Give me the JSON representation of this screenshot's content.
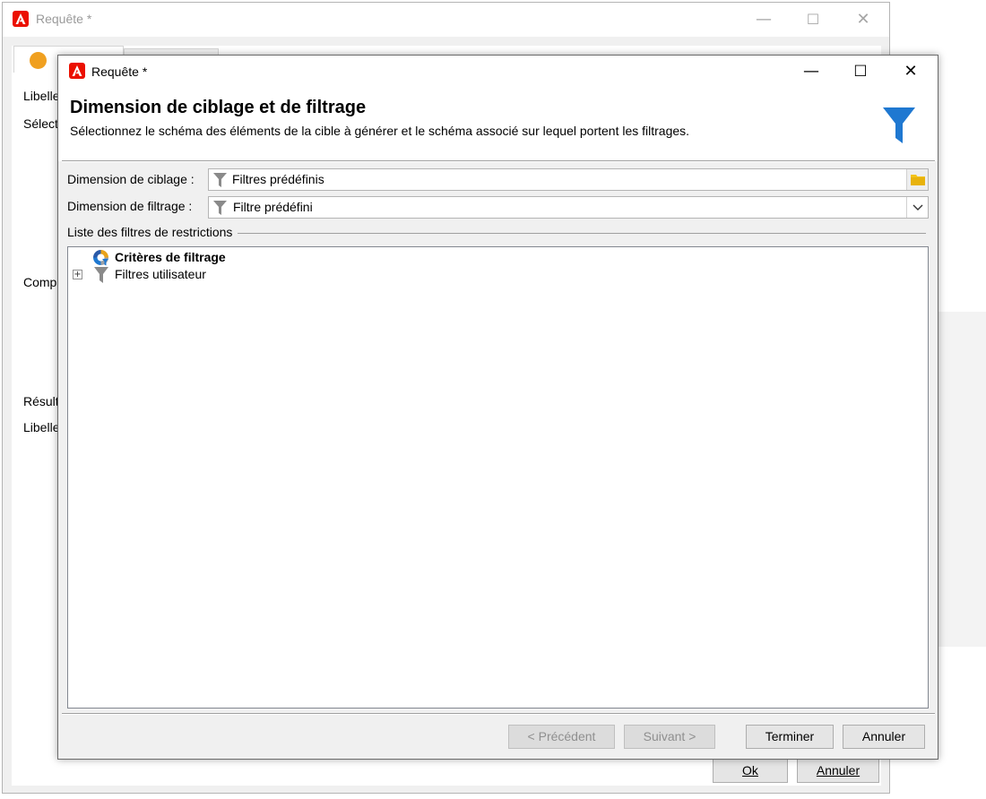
{
  "back_window": {
    "title": "Requête *",
    "labels": [
      "Libelle",
      "Sélect",
      "Comp",
      "Résult",
      "Libelle"
    ],
    "ok_label": "Ok",
    "cancel_label": "Annuler"
  },
  "dialog": {
    "title": "Requête *",
    "header_title": "Dimension de ciblage et de filtrage",
    "header_description": "Sélectionnez le schéma des éléments de la cible à générer et le schéma associé sur lequel portent les filtrages.",
    "targeting_label": "Dimension de ciblage :",
    "targeting_value": "Filtres prédéfinis",
    "filtering_label": "Dimension de filtrage :",
    "filtering_value": "Filtre prédéfini",
    "list_group_label": "Liste des filtres de restrictions",
    "tree_items": [
      {
        "label": "Critères de filtrage",
        "bold": true,
        "icon": "filter-criteria-icon"
      },
      {
        "label": "Filtres utilisateur",
        "bold": false,
        "icon": "funnel-icon"
      }
    ],
    "buttons": {
      "previous": "< Précédent",
      "next": "Suivant >",
      "finish": "Terminer",
      "cancel": "Annuler"
    }
  },
  "colors": {
    "accent_funnel": "#1f78d1",
    "adobe_red": "#eb1000",
    "orange_dot": "#f0a020"
  }
}
